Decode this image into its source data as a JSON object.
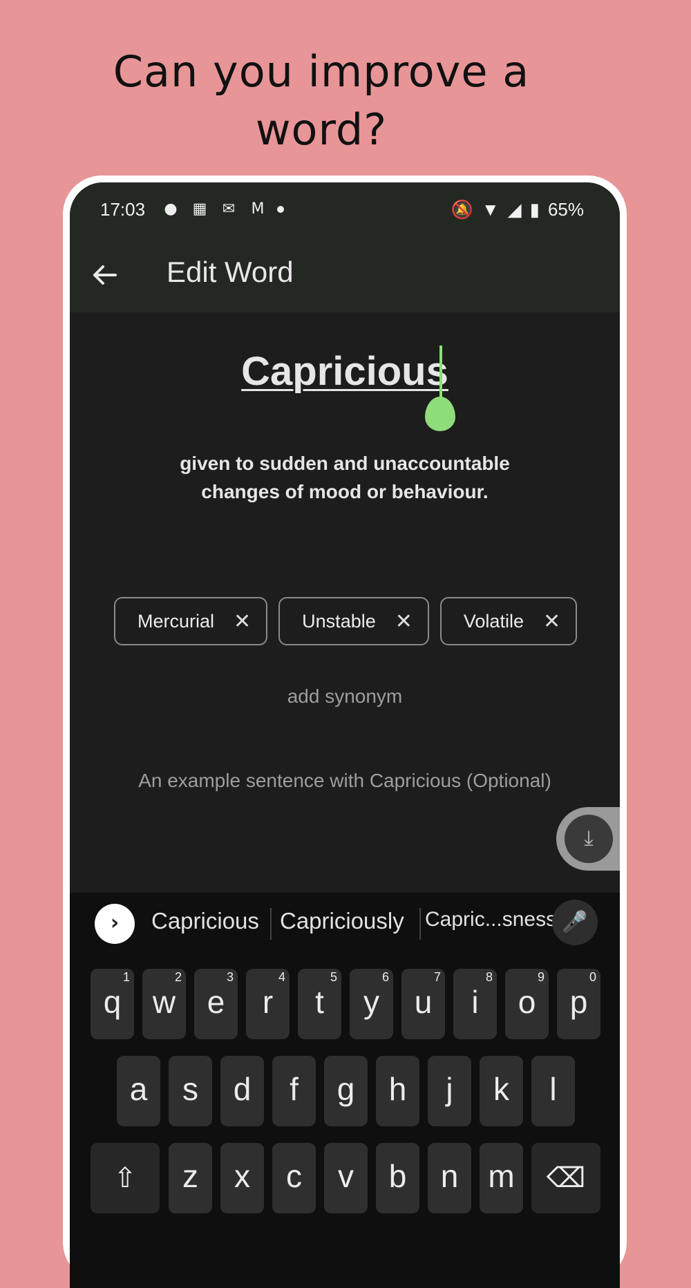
{
  "promo": {
    "title_line1": "Can you improve a",
    "title_line2": "word?"
  },
  "status_bar": {
    "time": "17:03",
    "battery": "65%"
  },
  "app_bar": {
    "title": "Edit Word"
  },
  "word": {
    "text": "Capricious",
    "definition_line1": "given to sudden and unaccountable",
    "definition_line2": "changes of mood or behaviour."
  },
  "synonyms": [
    "Mercurial",
    "Unstable",
    "Volatile"
  ],
  "add_synonym": "add synonym",
  "example_placeholder": "An example sentence with Capricious (Optional)",
  "keyboard": {
    "suggestions": [
      "Capricious",
      "Capriciously",
      "Capric...sness"
    ],
    "row1": [
      "q",
      "w",
      "e",
      "r",
      "t",
      "y",
      "u",
      "i",
      "o",
      "p"
    ],
    "row1_hints": [
      "1",
      "2",
      "3",
      "4",
      "5",
      "6",
      "7",
      "8",
      "9",
      "0"
    ],
    "row2": [
      "a",
      "s",
      "d",
      "f",
      "g",
      "h",
      "j",
      "k",
      "l"
    ],
    "row3": [
      "z",
      "x",
      "c",
      "v",
      "b",
      "n",
      "m"
    ]
  },
  "colors": {
    "background": "#e89597",
    "accent": "#8fdc7a",
    "surface": "#1c1d1c"
  }
}
